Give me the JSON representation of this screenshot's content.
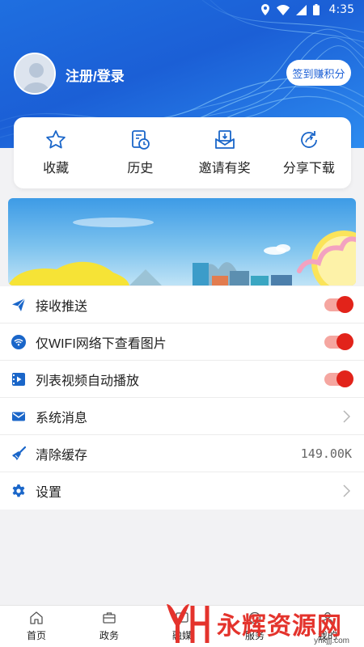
{
  "status_bar": {
    "time": "4:35"
  },
  "profile": {
    "login_label": "注册/登录",
    "signin_button": "签到赚积分"
  },
  "quick_actions": [
    {
      "label": "收藏",
      "icon": "star-icon"
    },
    {
      "label": "历史",
      "icon": "history-icon"
    },
    {
      "label": "邀请有奖",
      "icon": "invite-icon"
    },
    {
      "label": "分享下载",
      "icon": "share-icon"
    }
  ],
  "settings": {
    "push": {
      "label": "接收推送",
      "icon": "send-icon",
      "enabled": true
    },
    "wifi_images": {
      "label": "仅WIFI网络下查看图片",
      "icon": "wifi-icon",
      "enabled": true
    },
    "autoplay": {
      "label": "列表视频自动播放",
      "icon": "video-icon",
      "enabled": true
    },
    "messages": {
      "label": "系统消息",
      "icon": "mail-icon"
    },
    "cache": {
      "label": "清除缓存",
      "icon": "broom-icon",
      "value": "149.00K"
    },
    "preferences": {
      "label": "设置",
      "icon": "gear-icon"
    }
  },
  "bottom_nav": [
    {
      "label": "首页",
      "icon": "home-icon"
    },
    {
      "label": "政务",
      "icon": "briefcase-icon"
    },
    {
      "label": "融媒",
      "icon": "media-icon"
    },
    {
      "label": "服务",
      "icon": "service-icon"
    },
    {
      "label": "我的",
      "icon": "user-icon"
    }
  ],
  "watermark": {
    "text": "永辉资源网",
    "url": "yhkjjj.com"
  },
  "colors": {
    "primary": "#1b5fd6",
    "toggle_on": "#e2231a",
    "toggle_track": "#f5a6a0",
    "icon_blue": "#1a66c9"
  }
}
